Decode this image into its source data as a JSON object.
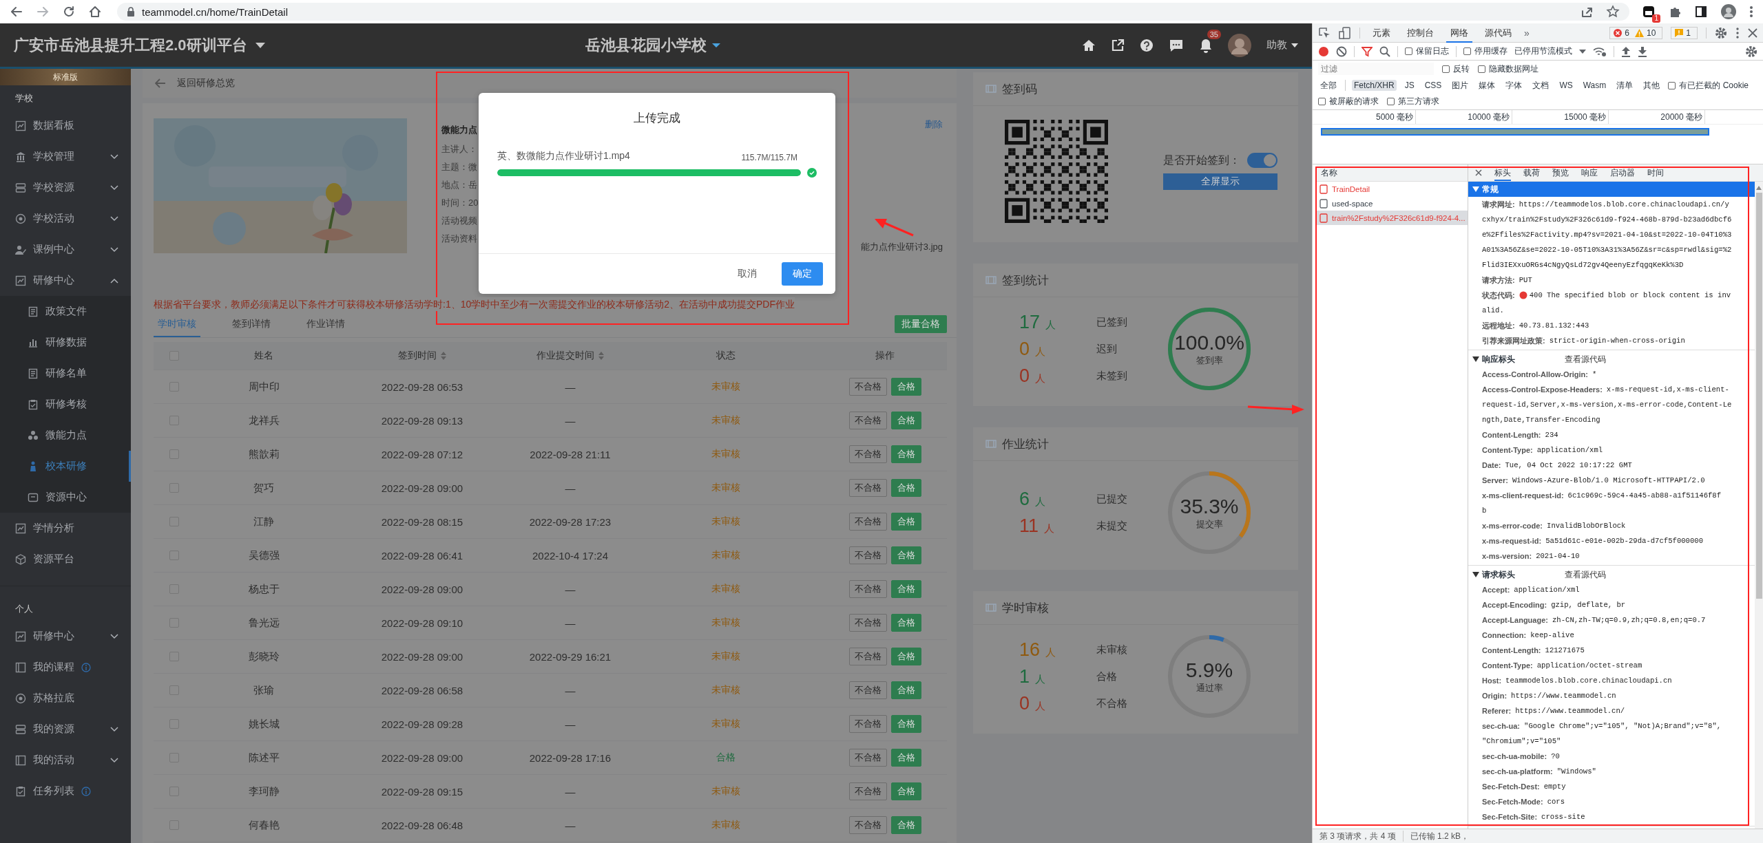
{
  "browser": {
    "url": "teammodel.cn/home/TrainDetail",
    "extension_badge": "1"
  },
  "header": {
    "title": "广安市岳池县提升工程2.0研训平台",
    "school": "岳池县花园小学校",
    "notification_count": "35",
    "user": "助教"
  },
  "sidebar": {
    "edition": "标准版",
    "sections": [
      {
        "label": "学校",
        "items": [
          {
            "label": "数据看板",
            "selected": false
          },
          {
            "label": "学校管理",
            "selected": false,
            "expanded": false
          },
          {
            "label": "学校资源",
            "selected": false,
            "expanded": false
          },
          {
            "label": "学校活动",
            "selected": false,
            "expanded": false
          },
          {
            "label": "课例中心",
            "selected": false,
            "expanded": false
          },
          {
            "label": "研修中心",
            "selected": false,
            "expanded": true,
            "children": [
              {
                "label": "政策文件",
                "selected": false
              },
              {
                "label": "研修数据",
                "selected": false
              },
              {
                "label": "研修名单",
                "selected": false
              },
              {
                "label": "研修考核",
                "selected": false
              },
              {
                "label": "微能力点",
                "selected": false
              },
              {
                "label": "校本研修",
                "selected": true
              },
              {
                "label": "资源中心",
                "selected": false
              }
            ]
          },
          {
            "label": "学情分析",
            "selected": false
          },
          {
            "label": "资源平台",
            "selected": false
          }
        ]
      },
      {
        "label": "个人",
        "items": [
          {
            "label": "研修中心",
            "selected": false,
            "expanded": false
          },
          {
            "label": "我的课程",
            "selected": false,
            "info": true
          },
          {
            "label": "苏格拉底",
            "selected": false
          },
          {
            "label": "我的资源",
            "selected": false,
            "expanded": false
          },
          {
            "label": "我的活动",
            "selected": false,
            "expanded": false
          },
          {
            "label": "任务列表",
            "selected": false,
            "info": true
          }
        ]
      }
    ]
  },
  "main": {
    "back_link": "返回研修总览",
    "activity": {
      "kind": "picture",
      "title": "微能力点",
      "delete": "删除",
      "fields": [
        "主讲人：",
        "主题：微",
        "地点：岳",
        "时间：20",
        "活动视频",
        "活动资料"
      ],
      "attachment": "能力点作业研讨3.jpg"
    },
    "notice": "根据省平台要求，教师必须满足以下条件才可获得校本研修活动学时:1、10学时中至少有一次需提交作业的校本研修活动2、在活动中成功提交PDF作业",
    "tabs": [
      {
        "label": "学时审核",
        "selected": true
      },
      {
        "label": "签到详情",
        "selected": false
      },
      {
        "label": "作业详情",
        "selected": false
      }
    ],
    "batch_button": "批量合格",
    "table": {
      "all_checked": false,
      "columns": [
        {
          "label": "姓名",
          "sortable": false
        },
        {
          "label": "签到时间",
          "sortable": true
        },
        {
          "label": "作业提交时间",
          "sortable": true
        },
        {
          "label": "状态",
          "sortable": false
        },
        {
          "label": "操作",
          "sortable": false
        }
      ],
      "rows": [
        {
          "checked": false,
          "name": "周中印",
          "checkin": "2022-09-28 06:53",
          "submitted": "—",
          "status": "未审核",
          "color": "#8f5a10",
          "actions": [
            "不合格",
            "合格"
          ]
        },
        {
          "checked": false,
          "name": "龙祥兵",
          "checkin": "2022-09-28 09:13",
          "submitted": "—",
          "status": "未审核",
          "color": "#8f5a10",
          "actions": [
            "不合格",
            "合格"
          ]
        },
        {
          "checked": false,
          "name": "熊歆莉",
          "checkin": "2022-09-28 07:12",
          "submitted": "2022-09-28 21:11",
          "status": "未审核",
          "color": "#8f5a10",
          "actions": [
            "不合格",
            "合格"
          ]
        },
        {
          "checked": false,
          "name": "贺巧",
          "checkin": "2022-09-28 09:00",
          "submitted": "—",
          "status": "未审核",
          "color": "#8f5a10",
          "actions": [
            "不合格",
            "合格"
          ]
        },
        {
          "checked": false,
          "name": "江静",
          "checkin": "2022-09-28 08:15",
          "submitted": "2022-09-28 17:23",
          "status": "未审核",
          "color": "#8f5a10",
          "actions": [
            "不合格",
            "合格"
          ]
        },
        {
          "checked": false,
          "name": "吴德强",
          "checkin": "2022-09-28 06:41",
          "submitted": "2022-10-4 17:24",
          "status": "未审核",
          "color": "#8f5a10",
          "actions": [
            "不合格",
            "合格"
          ]
        },
        {
          "checked": false,
          "name": "杨忠于",
          "checkin": "2022-09-28 09:00",
          "submitted": "—",
          "status": "未审核",
          "color": "#8f5a10",
          "actions": [
            "不合格",
            "合格"
          ]
        },
        {
          "checked": false,
          "name": "鲁光远",
          "checkin": "2022-09-28 09:10",
          "submitted": "—",
          "status": "未审核",
          "color": "#8f5a10",
          "actions": [
            "不合格",
            "合格"
          ]
        },
        {
          "checked": false,
          "name": "彭晓玲",
          "checkin": "2022-09-28 09:00",
          "submitted": "2022-09-29 16:21",
          "status": "未审核",
          "color": "#8f5a10",
          "actions": [
            "不合格",
            "合格"
          ]
        },
        {
          "checked": false,
          "name": "张瑜",
          "checkin": "2022-09-28 06:58",
          "submitted": "—",
          "status": "未审核",
          "color": "#8f5a10",
          "actions": [
            "不合格",
            "合格"
          ]
        },
        {
          "checked": false,
          "name": "姚长城",
          "checkin": "2022-09-28 09:28",
          "submitted": "—",
          "status": "未审核",
          "color": "#8f5a10",
          "actions": [
            "不合格",
            "合格"
          ]
        },
        {
          "checked": false,
          "name": "陈述平",
          "checkin": "2022-09-28 09:00",
          "submitted": "2022-09-28 17:16",
          "status": "合格",
          "color": "#1f6b3f",
          "actions": [
            "不合格",
            "合格"
          ]
        },
        {
          "checked": false,
          "name": "李珂静",
          "checkin": "2022-09-28 09:15",
          "submitted": "—",
          "status": "未审核",
          "color": "#8f5a10",
          "actions": [
            "不合格",
            "合格"
          ]
        },
        {
          "checked": false,
          "name": "何春艳",
          "checkin": "2022-09-28 06:48",
          "submitted": "—",
          "status": "未审核",
          "color": "#8f5a10",
          "actions": [
            "不合格",
            "合格"
          ]
        }
      ]
    }
  },
  "checkin_code": {
    "title": "签到码",
    "toggle_label": "是否开始签到：",
    "toggle_on": true,
    "button": "全屏显示"
  },
  "stat_cards": [
    {
      "title": "签到统计",
      "rate": "100.0%",
      "rate_label": "签到率",
      "level": 1,
      "color": "#2e7d4f",
      "items": [
        {
          "count": "17",
          "unit": "人",
          "label": "已签到",
          "color": "#1f6b3f"
        },
        {
          "count": "0",
          "unit": "人",
          "label": "迟到",
          "color": "#8f5a10"
        },
        {
          "count": "0",
          "unit": "人",
          "label": "未签到",
          "color": "#9a3322"
        }
      ]
    },
    {
      "title": "作业统计",
      "rate": "35.3%",
      "rate_label": "提交率",
      "level": 0.353,
      "color": "#b9761c",
      "items": [
        {
          "count": "6",
          "unit": "人",
          "label": "已提交",
          "color": "#1f6b3f"
        },
        {
          "count": "11",
          "unit": "人",
          "label": "未提交",
          "color": "#9a3322"
        }
      ]
    },
    {
      "title": "学时审核",
      "rate": "5.9%",
      "rate_label": "通过率",
      "level": 0.059,
      "color": "#2f6aa8",
      "items": [
        {
          "count": "16",
          "unit": "人",
          "label": "未审核",
          "color": "#8f5a10"
        },
        {
          "count": "1",
          "unit": "人",
          "label": "合格",
          "color": "#1f6b3f"
        },
        {
          "count": "0",
          "unit": "人",
          "label": "不合格",
          "color": "#9a3322"
        }
      ]
    }
  ],
  "modal": {
    "title": "上传完成",
    "file": "英、数微能力点作业研讨1.mp4",
    "size": "115.7M/115.7M",
    "level": 1,
    "complete": true,
    "buttons": [
      {
        "label": "取消",
        "kind": "text"
      },
      {
        "label": "确定",
        "kind": "primary"
      }
    ]
  },
  "devtools": {
    "tabs": [
      {
        "label": "元素",
        "selected": false
      },
      {
        "label": "控制台",
        "selected": false
      },
      {
        "label": "网络",
        "selected": true
      },
      {
        "label": "源代码",
        "selected": false
      }
    ],
    "more": "»",
    "errors": "6",
    "warnings": "10",
    "issues": "1",
    "toolbar": {
      "recording": true,
      "checkboxes": [
        {
          "label": "保留日志",
          "checked": false
        },
        {
          "label": "停用缓存",
          "checked": false
        }
      ],
      "throttling": "已停用节流模式"
    },
    "filter": {
      "placeholder": "过滤",
      "checkboxes": [
        {
          "label": "反转",
          "checked": false
        },
        {
          "label": "隐藏数据网址",
          "checked": false
        }
      ]
    },
    "types": [
      {
        "label": "全部",
        "selected": false
      },
      {
        "label": "Fetch/XHR",
        "selected": true
      },
      {
        "label": "JS",
        "selected": false
      },
      {
        "label": "CSS",
        "selected": false
      },
      {
        "label": "图片",
        "selected": false
      },
      {
        "label": "媒体",
        "selected": false
      },
      {
        "label": "字体",
        "selected": false
      },
      {
        "label": "文档",
        "selected": false
      },
      {
        "label": "WS",
        "selected": false
      },
      {
        "label": "Wasm",
        "selected": false
      },
      {
        "label": "清单",
        "selected": false
      },
      {
        "label": "其他",
        "selected": false
      }
    ],
    "blocked_cookies": {
      "label": "有已拦截的 Cookie",
      "checked": false
    },
    "extra_filters": [
      {
        "label": "被屏蔽的请求",
        "checked": false
      },
      {
        "label": "第三方请求",
        "checked": false
      }
    ],
    "timeline": {
      "ticks": [
        "5000 毫秒",
        "10000 毫秒",
        "15000 毫秒",
        "20000 毫秒"
      ]
    },
    "requests": {
      "header": "名称",
      "items": [
        {
          "name": "TrainDetail",
          "error": true,
          "selected": false
        },
        {
          "name": "used-space",
          "error": false,
          "selected": false
        },
        {
          "name": "train%2Fstudy%2F326c61d9-f924-4...",
          "error": true,
          "selected": true
        }
      ]
    },
    "detail_tabs": [
      {
        "label": "标头",
        "selected": true
      },
      {
        "label": "载荷",
        "selected": false
      },
      {
        "label": "预览",
        "selected": false
      },
      {
        "label": "响应",
        "selected": false
      },
      {
        "label": "启动器",
        "selected": false
      },
      {
        "label": "时间",
        "selected": false
      }
    ],
    "sections": [
      {
        "title": "常规",
        "kind": "general",
        "rows": [
          {
            "key": "请求网址:",
            "lines": [
              "https://teammodelos.blob.core.chinacloudapi.cn/y",
              "cxhyx/train%2Fstudy%2F326c61d9-f924-468b-879d-b23ad6dbcf6",
              "e%2Ffiles%2Factivity.mp4?sv=2021-04-10&st=2022-10-04T10%3",
              "A01%3A56Z&se=2022-10-05T10%3A31%3A56Z&sr=c&sp=rwdl&sig=%2",
              "Flid3IEXxuORGs4cNgyQsLd72gv4QeenyEzfqgqKeKk%3D"
            ]
          },
          {
            "key": "请求方法:",
            "lines": [
              "PUT"
            ]
          },
          {
            "key": "状态代码:",
            "error_dot": true,
            "lines": [
              "400 The specified blob or block content is inv",
              "alid."
            ]
          },
          {
            "key": "远程地址:",
            "lines": [
              "40.73.81.132:443"
            ]
          },
          {
            "key": "引荐来源网址政策:",
            "lines": [
              "strict-origin-when-cross-origin"
            ]
          }
        ]
      },
      {
        "title": "响应标头",
        "kind": "headers",
        "view_source": "查看源代码",
        "rows": [
          {
            "key": "Access-Control-Allow-Origin:",
            "lines": [
              "*"
            ]
          },
          {
            "key": "Access-Control-Expose-Headers:",
            "lines": [
              "x-ms-request-id,x-ms-client-",
              "request-id,Server,x-ms-version,x-ms-error-code,Content-Le",
              "ngth,Date,Transfer-Encoding"
            ]
          },
          {
            "key": "Content-Length:",
            "lines": [
              "234"
            ]
          },
          {
            "key": "Content-Type:",
            "lines": [
              "application/xml"
            ]
          },
          {
            "key": "Date:",
            "lines": [
              "Tue, 04 Oct 2022 10:17:22 GMT"
            ]
          },
          {
            "key": "Server:",
            "lines": [
              "Windows-Azure-Blob/1.0 Microsoft-HTTPAPI/2.0"
            ]
          },
          {
            "key": "x-ms-client-request-id:",
            "lines": [
              "6c1c969c-59c4-4a45-ab88-a1f51146f8f",
              "b"
            ]
          },
          {
            "key": "x-ms-error-code:",
            "lines": [
              "InvalidBlobOrBlock"
            ]
          },
          {
            "key": "x-ms-request-id:",
            "lines": [
              "5a51d61c-e01e-002b-29da-d7cf5f000000"
            ]
          },
          {
            "key": "x-ms-version:",
            "lines": [
              "2021-04-10"
            ]
          }
        ]
      },
      {
        "title": "请求标头",
        "kind": "headers",
        "view_source": "查看源代码",
        "rows": [
          {
            "key": "Accept:",
            "lines": [
              "application/xml"
            ]
          },
          {
            "key": "Accept-Encoding:",
            "lines": [
              "gzip, deflate, br"
            ]
          },
          {
            "key": "Accept-Language:",
            "lines": [
              "zh-CN,zh-TW;q=0.9,zh;q=0.8,en;q=0.7"
            ]
          },
          {
            "key": "Connection:",
            "lines": [
              "keep-alive"
            ]
          },
          {
            "key": "Content-Length:",
            "lines": [
              "121271675"
            ]
          },
          {
            "key": "Content-Type:",
            "lines": [
              "application/octet-stream"
            ]
          },
          {
            "key": "Host:",
            "lines": [
              "teammodelos.blob.core.chinacloudapi.cn"
            ]
          },
          {
            "key": "Origin:",
            "lines": [
              "https://www.teammodel.cn"
            ]
          },
          {
            "key": "Referer:",
            "lines": [
              "https://www.teammodel.cn/"
            ]
          },
          {
            "key": "sec-ch-ua:",
            "lines": [
              "\"Google Chrome\";v=\"105\", \"Not)A;Brand\";v=\"8\",",
              "\"Chromium\";v=\"105\""
            ]
          },
          {
            "key": "sec-ch-ua-mobile:",
            "lines": [
              "?0"
            ]
          },
          {
            "key": "sec-ch-ua-platform:",
            "lines": [
              "\"Windows\""
            ]
          },
          {
            "key": "Sec-Fetch-Dest:",
            "lines": [
              "empty"
            ]
          },
          {
            "key": "Sec-Fetch-Mode:",
            "lines": [
              "cors"
            ]
          },
          {
            "key": "Sec-Fetch-Site:",
            "lines": [
              "cross-site"
            ]
          }
        ]
      }
    ],
    "footer": [
      "第 3 项请求，共 4 项",
      "已传输 1.2 kB，"
    ]
  }
}
